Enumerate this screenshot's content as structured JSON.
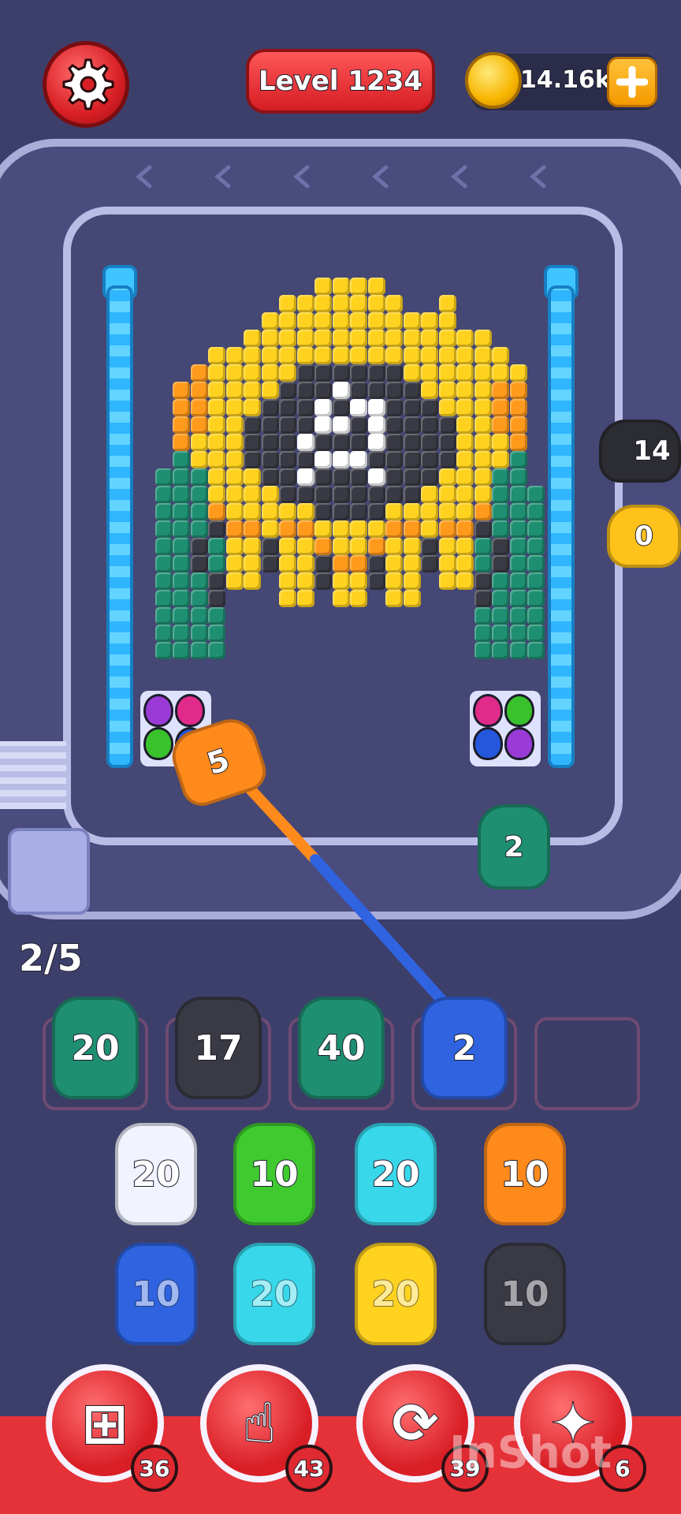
{
  "header": {
    "level_label": "Level 1234",
    "coins": "14.16k"
  },
  "progress_label": "2/5",
  "conveyor": {
    "right_top_count": "14",
    "right_mid_count": "0",
    "active_shooter_count": "5",
    "track_piece_count": "2"
  },
  "slots": [
    "20",
    "17",
    "40",
    "2",
    ""
  ],
  "queue": {
    "row1": [
      "20",
      "10",
      "20",
      "10"
    ],
    "row2": [
      "10",
      "20",
      "20",
      "10"
    ]
  },
  "boosters": [
    {
      "icon": "add-slot-icon",
      "count": "36"
    },
    {
      "icon": "hand-tap-icon",
      "count": "43"
    },
    {
      "icon": "shuffle-icon",
      "count": "39"
    },
    {
      "icon": "magnet-icon",
      "count": "6"
    }
  ],
  "watermark": "InShot",
  "colors": {
    "teal": "#1f8f72",
    "black": "#3a3a44",
    "blue": "#2f63e0",
    "white": "#f1f3ff",
    "green": "#3fcb2f",
    "cyan": "#38d7ea",
    "orange": "#ff8a1c",
    "yellow": "#ffd21f"
  }
}
